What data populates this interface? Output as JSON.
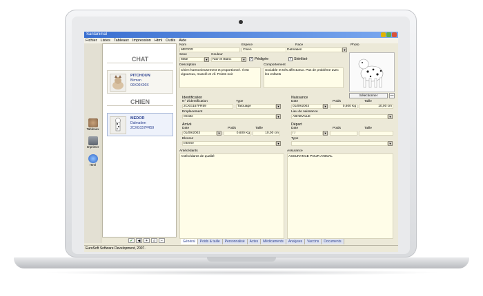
{
  "window": {
    "title": "Santanimal"
  },
  "menu": [
    "Fichier",
    "Listes",
    "Tableaux",
    "Impression",
    "Html",
    "Outils",
    "Aide"
  ],
  "tools": [
    "Tableaux",
    "Imprimer",
    "Html"
  ],
  "list": {
    "section_chat": "CHAT",
    "section_chien": "CHIEN",
    "cards": [
      {
        "name": "PITCHOUN",
        "race": "Birman",
        "id": "00X00X00X"
      },
      {
        "name": "MEDOR",
        "race": "Dalmatien",
        "id": "2CXG157FR59"
      }
    ]
  },
  "form": {
    "nom_label": "Nom",
    "nom": "MEDOR",
    "espece_label": "Espèce",
    "espece": "Chien",
    "race_label": "Race",
    "race": "Dalmatien",
    "photo_label": "Photo",
    "sexe_label": "Sexe",
    "sexe": "Mâle",
    "couleur_label": "Couleur",
    "couleur": "Noir et Blanc",
    "pedigree_label": "Pédigée",
    "sterilise_label": "Stérilisé",
    "description_label": "Description",
    "description": "Chien harmonieusement et proportionné.  Il est vigoureux, musclé et vif. Points noir",
    "comportement_label": "Comportement",
    "comportement": "Sociable et très affectueux. Pas de problème avec les enfants",
    "select_button": "Sélectionner",
    "minus_button": "—",
    "identification": {
      "title": "Identification",
      "num_label": "N° d'identification",
      "num": "2CXG157FR59",
      "type_label": "Type",
      "type": "Tatouage",
      "emplacement_label": "Emplacement",
      "emplacement": "Oreille"
    },
    "naissance": {
      "title": "Naissance",
      "date_label": "Date",
      "date": "01/09/2003",
      "poids_label": "Poids",
      "poids": "0,600 Kg",
      "taille_label": "Taille",
      "taille": "10,00 cm",
      "lieu_label": "Lieu de naissance",
      "lieu": "ABABVILLE"
    },
    "arrive": {
      "title": "Arrivé",
      "date_label": "Date",
      "date": "01/09/2003",
      "poids_label": "Poids",
      "poids": "0,600 Kg",
      "taille_label": "Taille",
      "taille": "10,00 cm",
      "eleveur_label": "Eleveur",
      "eleveur": "Interne"
    },
    "depart": {
      "title": "Départ",
      "date_label": "Date",
      "date": " / /",
      "poids_label": "Poids",
      "taille_label": "Taille",
      "type_label": "Type"
    },
    "antecedents_label": "Antécédants",
    "antecedents": "Antécédants de qualité",
    "assurance_label": "Assurance",
    "assurance": "ASSURANCE POUR ANIMAL"
  },
  "tabs": [
    "Général",
    "Poids & taille",
    "Personnalisé",
    "Actes",
    "Médicaments",
    "Analyses",
    "Vaccins",
    "Documents"
  ],
  "status": "EuroSoft Software Development, 2007."
}
